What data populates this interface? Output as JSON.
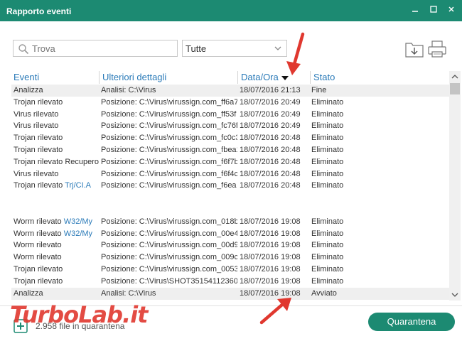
{
  "window": {
    "title": "Rapporto eventi"
  },
  "toolbar": {
    "search_placeholder": "Trova",
    "filter_value": "Tutte"
  },
  "table": {
    "columns": [
      "Eventi",
      "Ulteriori dettagli",
      "Data/Ora",
      "Stato"
    ],
    "rows": [
      {
        "event": "Analizza",
        "link": "",
        "details": "Analisi: C:\\Virus",
        "date": "18/07/2016 21:13",
        "status": "Fine"
      },
      {
        "event": "Trojan rilevato",
        "link": "",
        "details": "Posizione: C:\\Virus\\virussign.com_ff6a7",
        "date": "18/07/2016 20:49",
        "status": "Eliminato"
      },
      {
        "event": "Virus rilevato",
        "link": "",
        "details": "Posizione: C:\\Virus\\virussign.com_ff53f",
        "date": "18/07/2016 20:49",
        "status": "Eliminato"
      },
      {
        "event": "Virus rilevato",
        "link": "",
        "details": "Posizione: C:\\Virus\\virussign.com_fc76f",
        "date": "18/07/2016 20:49",
        "status": "Eliminato"
      },
      {
        "event": "Trojan rilevato",
        "link": "",
        "details": "Posizione: C:\\Virus\\virussign.com_fc0c3",
        "date": "18/07/2016 20:48",
        "status": "Eliminato"
      },
      {
        "event": "Trojan rilevato",
        "link": "",
        "details": "Posizione: C:\\Virus\\virussign.com_fbea1",
        "date": "18/07/2016 20:48",
        "status": "Eliminato"
      },
      {
        "event": "Trojan rilevato Recupero",
        "link": "",
        "details": "Posizione: C:\\Virus\\virussign.com_f6f7b",
        "date": "18/07/2016 20:48",
        "status": "Eliminato"
      },
      {
        "event": "Virus rilevato",
        "link": "",
        "details": "Posizione: C:\\Virus\\virussign.com_f6f4c",
        "date": "18/07/2016 20:48",
        "status": "Eliminato"
      },
      {
        "event": "Trojan rilevato ",
        "link": "Trj/CI.A",
        "details": "Posizione: C:\\Virus\\virussign.com_f6ea",
        "date": "18/07/2016 20:48",
        "status": "Eliminato"
      },
      {
        "event": "Worm rilevato ",
        "link": "W32/My",
        "details": "Posizione: C:\\Virus\\virussign.com_018b",
        "date": "18/07/2016 19:08",
        "status": "Eliminato"
      },
      {
        "event": "Worm rilevato ",
        "link": "W32/My",
        "details": "Posizione: C:\\Virus\\virussign.com_00e4",
        "date": "18/07/2016 19:08",
        "status": "Eliminato"
      },
      {
        "event": "Worm rilevato",
        "link": "",
        "details": "Posizione: C:\\Virus\\virussign.com_00d9",
        "date": "18/07/2016 19:08",
        "status": "Eliminato"
      },
      {
        "event": "Worm rilevato",
        "link": "",
        "details": "Posizione: C:\\Virus\\virussign.com_009c",
        "date": "18/07/2016 19:08",
        "status": "Eliminato"
      },
      {
        "event": "Trojan rilevato",
        "link": "",
        "details": "Posizione: C:\\Virus\\virussign.com_0053",
        "date": "18/07/2016 19:08",
        "status": "Eliminato"
      },
      {
        "event": "Trojan rilevato",
        "link": "",
        "details": "Posizione: C:\\Virus\\SHOT351541123604",
        "date": "18/07/2016 19:08",
        "status": "Eliminato"
      },
      {
        "event": "Analizza",
        "link": "",
        "details": "Analisi: C:\\Virus",
        "date": "18/07/2016 19:08",
        "status": "Avviato"
      }
    ]
  },
  "footer": {
    "status_text": "2.958 file in quarantena",
    "quarantine_button": "Quarantena"
  },
  "watermark": {
    "text": "TurboLab.it"
  },
  "colors": {
    "accent": "#1c8a72",
    "link": "#2a7ab8",
    "annotation": "#e0382f"
  }
}
